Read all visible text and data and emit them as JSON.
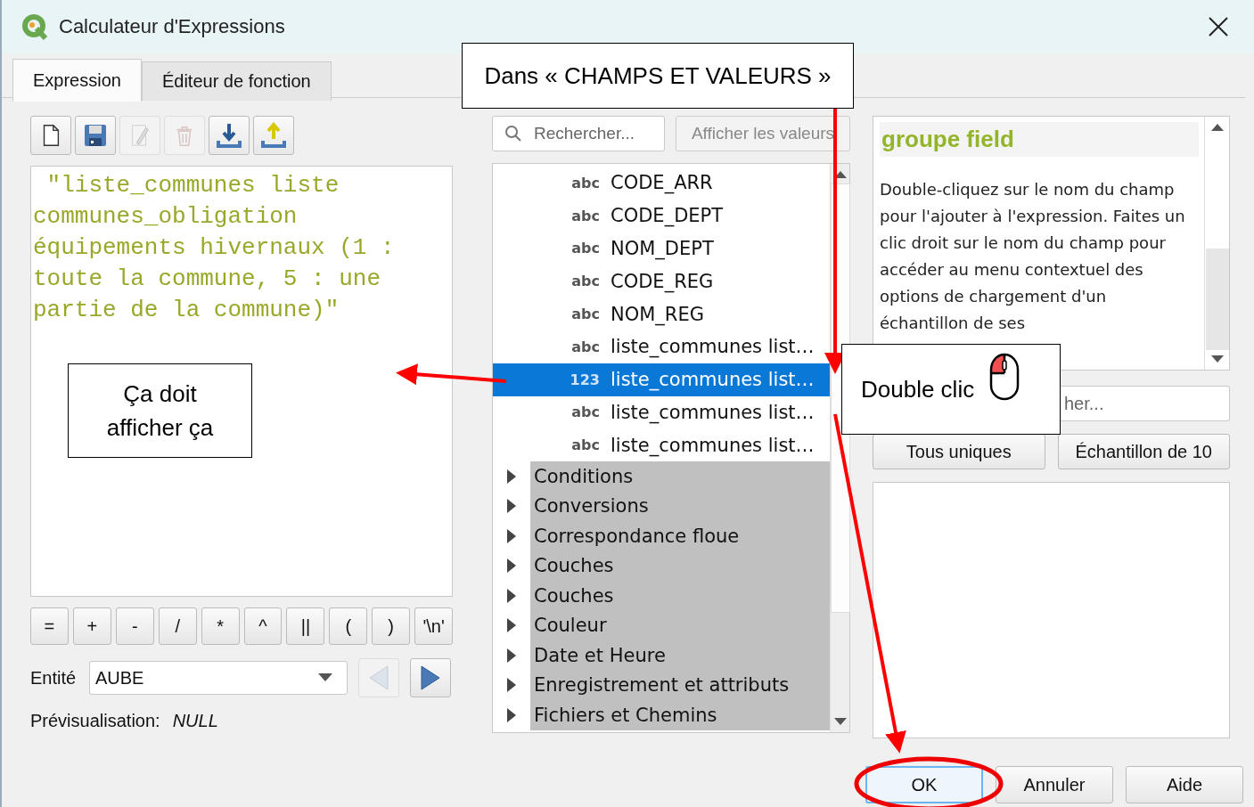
{
  "window": {
    "title": "Calculateur d'Expressions"
  },
  "tabs": [
    {
      "label": "Expression",
      "selected": true
    },
    {
      "label": "Éditeur de fonction",
      "selected": false
    }
  ],
  "toolbar": [
    {
      "kind": "new",
      "disabled": false
    },
    {
      "kind": "save",
      "disabled": false
    },
    {
      "kind": "edit",
      "disabled": true
    },
    {
      "kind": "delete",
      "disabled": true
    },
    {
      "kind": "import",
      "disabled": false
    },
    {
      "kind": "export",
      "disabled": false
    }
  ],
  "expression": " \"liste_communes liste communes_obligation équipements hivernaux (1 : toute la commune, 5 : une partie de la commune)\"",
  "operators": [
    "=",
    "+",
    "-",
    "/",
    "*",
    "^",
    "||",
    "(",
    ")",
    "'\\n'"
  ],
  "entity": {
    "label": "Entité",
    "value": "AUBE",
    "previous_disabled": true,
    "next_disabled": false
  },
  "preview": {
    "label": "Prévisualisation:",
    "value": "NULL"
  },
  "search": {
    "placeholder": "Rechercher..."
  },
  "show_values_button": "Afficher les valeurs",
  "tree": [
    {
      "kind": "field",
      "type": "abc",
      "label": "CODE_ARR",
      "selected": false
    },
    {
      "kind": "field",
      "type": "abc",
      "label": "CODE_DEPT",
      "selected": false
    },
    {
      "kind": "field",
      "type": "abc",
      "label": "NOM_DEPT",
      "selected": false
    },
    {
      "kind": "field",
      "type": "abc",
      "label": "CODE_REG",
      "selected": false
    },
    {
      "kind": "field",
      "type": "abc",
      "label": "NOM_REG",
      "selected": false
    },
    {
      "kind": "field",
      "type": "abc",
      "label": "liste_communes list…",
      "selected": false
    },
    {
      "kind": "field",
      "type": "123",
      "label": "liste_communes list…",
      "selected": true
    },
    {
      "kind": "field",
      "type": "abc",
      "label": "liste_communes list…",
      "selected": false
    },
    {
      "kind": "field",
      "type": "abc",
      "label": "liste_communes list…",
      "selected": false
    },
    {
      "kind": "group",
      "label": "Conditions",
      "selected": false
    },
    {
      "kind": "group",
      "label": "Conversions",
      "selected": false
    },
    {
      "kind": "group",
      "label": "Correspondance floue",
      "selected": false
    },
    {
      "kind": "group",
      "label": "Couches",
      "selected": false
    },
    {
      "kind": "group",
      "label": "Couches",
      "selected": false
    },
    {
      "kind": "group",
      "label": "Couleur",
      "selected": false
    },
    {
      "kind": "group",
      "label": "Date et Heure",
      "selected": false
    },
    {
      "kind": "group",
      "label": "Enregistrement et attributs",
      "selected": false
    },
    {
      "kind": "group",
      "label": "Fichiers et Chemins",
      "selected": false
    }
  ],
  "help": {
    "title": "groupe field",
    "text": "Double-cliquez sur le nom du champ pour l'ajouter à l'expression. Faites un clic droit sur le nom du champ pour accéder au menu contextuel des options de chargement d'un échantillon de ses"
  },
  "values_search": {
    "placeholder": "her..."
  },
  "values_buttons": [
    "Tous uniques",
    "Échantillon de 10"
  ],
  "dialog_buttons": [
    {
      "label": "OK",
      "default": true
    },
    {
      "label": "Annuler",
      "default": false
    },
    {
      "label": "Aide",
      "default": false
    }
  ],
  "annotations": [
    {
      "kind": "callout",
      "text": "Dans « CHAMPS ET VALEURS »"
    },
    {
      "kind": "callout",
      "text": "Ça doit afficher ça"
    },
    {
      "kind": "mouse_callout",
      "text": "Double clic"
    }
  ]
}
